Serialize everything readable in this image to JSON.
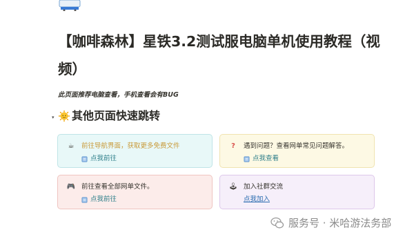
{
  "page": {
    "title": "【咖啡森林】星铁3.2测试服电脑单机使用教程（视频）",
    "note": "此页面推荐电脑查看，手机查看会有BUG",
    "section_heading": "其他页面快速跳转",
    "toggle_glyph": "▾"
  },
  "callouts": [
    {
      "icon": "☕",
      "text": "前往导航界面，获取更多免费文件",
      "link": "点我前往"
    },
    {
      "icon": "?",
      "text": "遇到问题？查看网单常见问题解答。",
      "link": "点我查看"
    },
    {
      "icon": "🎮",
      "text": "前往查看全部网单文件。",
      "link": "点我前往"
    },
    {
      "icon": "🕹",
      "text": "加入社群交流",
      "link": "点我加入"
    }
  ],
  "watermark": {
    "text": "服务号 · 米哈游法务部"
  },
  "colors": {
    "cyan_bg": "#e8f8f8",
    "yellow_bg": "#fdf9e4",
    "red_bg": "#fcecea",
    "purple_bg": "#f6effa",
    "link_teal": "#2f7f8a",
    "link_blue": "#2b6cb0",
    "orange_text": "#c99a3a"
  }
}
